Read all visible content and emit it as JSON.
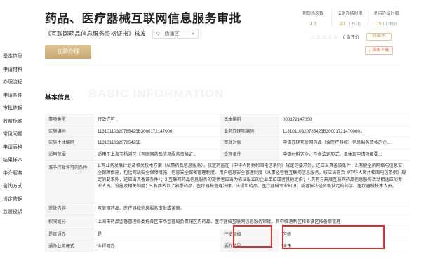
{
  "header": {
    "title": "药品、医疗器械互联网信息服务审批",
    "subtitle": "《互联网药品信息服务资格证书》核发",
    "location": "杨浦区",
    "apply_label": "立即办理"
  },
  "stats": [
    {
      "label": "到现场次数",
      "value": "0",
      "unit": "次"
    },
    {
      "label": "法定办结时限",
      "value": "20",
      "unit": "(工作日)"
    },
    {
      "label": "承诺办结时限",
      "value": "15",
      "unit": "(工作日)"
    }
  ],
  "rating": {
    "stars": "☆☆☆☆☆",
    "score_text": "0 条评价",
    "evaluate_label": "好差评"
  },
  "guide_download_label": "指南下载",
  "left_nav": [
    "基本信息",
    "申请材料",
    "办理流程",
    "申请条件",
    "审批依据",
    "收费标准",
    "常见问题",
    "申请表格",
    "结果样本",
    "中介服务",
    "咨询方式",
    "设定依据",
    "监督投诉"
  ],
  "section": {
    "title": "基本信息",
    "watermark": "BASIC INFORMATION"
  },
  "basic_info": {
    "rows": [
      {
        "k1": "事项类型",
        "v1": "行政许可",
        "k2": "基本编码",
        "v2": "000172147000"
      },
      {
        "k1": "实施编码",
        "v1": "11310110320785425B3000172147000",
        "k2": "业务办理项编码",
        "v2": "11310110320785425B300017214700001"
      },
      {
        "k1": "实施主体编码",
        "v1": "11310110320785425B",
        "k2": "审批对象",
        "v2": "申请办理互联网药品（含医疗器械）信息服务资格的企..."
      },
      {
        "k1": "适用范围",
        "v1": "适用于上海市杨浦区《互联网药品信息服务资格证...",
        "k2": "受理条件",
        "v2": "申请材料齐全，符合法定形式，且体现申请项目要..."
      }
    ],
    "conditions_label": "准予行政许可的条件",
    "conditions_text": "1.有业务发展计划及相关技术方案（从事药品信息服务），核定药监在《中华人民共和国电信条例》规定的要求外，还应当具备该条件；2.有健全的网络与信息安全保障措施，包括网站安全保障措施、信息安全保密管理制度、用户信息安全管理制度（从事经营性互联网信息服务，核应当符合《中华人民共和国电信条例》规定的要求外，还应当具备该条件）；3.互联网药品信息服务的提供者应当为依法设立的企业单位或者其他组织；4.具有与开展互联网药品信息服务活动相适应的专业人员、设施及相关制度；5.有两名以上熟悉药品、医疗器械管理法律、法规和药品、医疗器械专业知识，或者依法经资格认定的药学、医疗器械技术人员。",
    "content_label": "审批内容",
    "content_text": "互联网药品、医疗器械信息服务审批或备案。",
    "power_label": "权限划分",
    "power_text": "上海市药品监督管理局委托各区市场监管局负责辖区内药品、医疗器械互联网信息服务审批。其中临港新区和奉贤区按备案管理",
    "rows2": [
      {
        "k1": "是否通办",
        "v1": "是",
        "k2": "行使层级",
        "v2": "区级"
      },
      {
        "k1": "通办业务模式",
        "v1": "全程网办",
        "k2": "通办范围",
        "v2": "全市"
      }
    ]
  }
}
